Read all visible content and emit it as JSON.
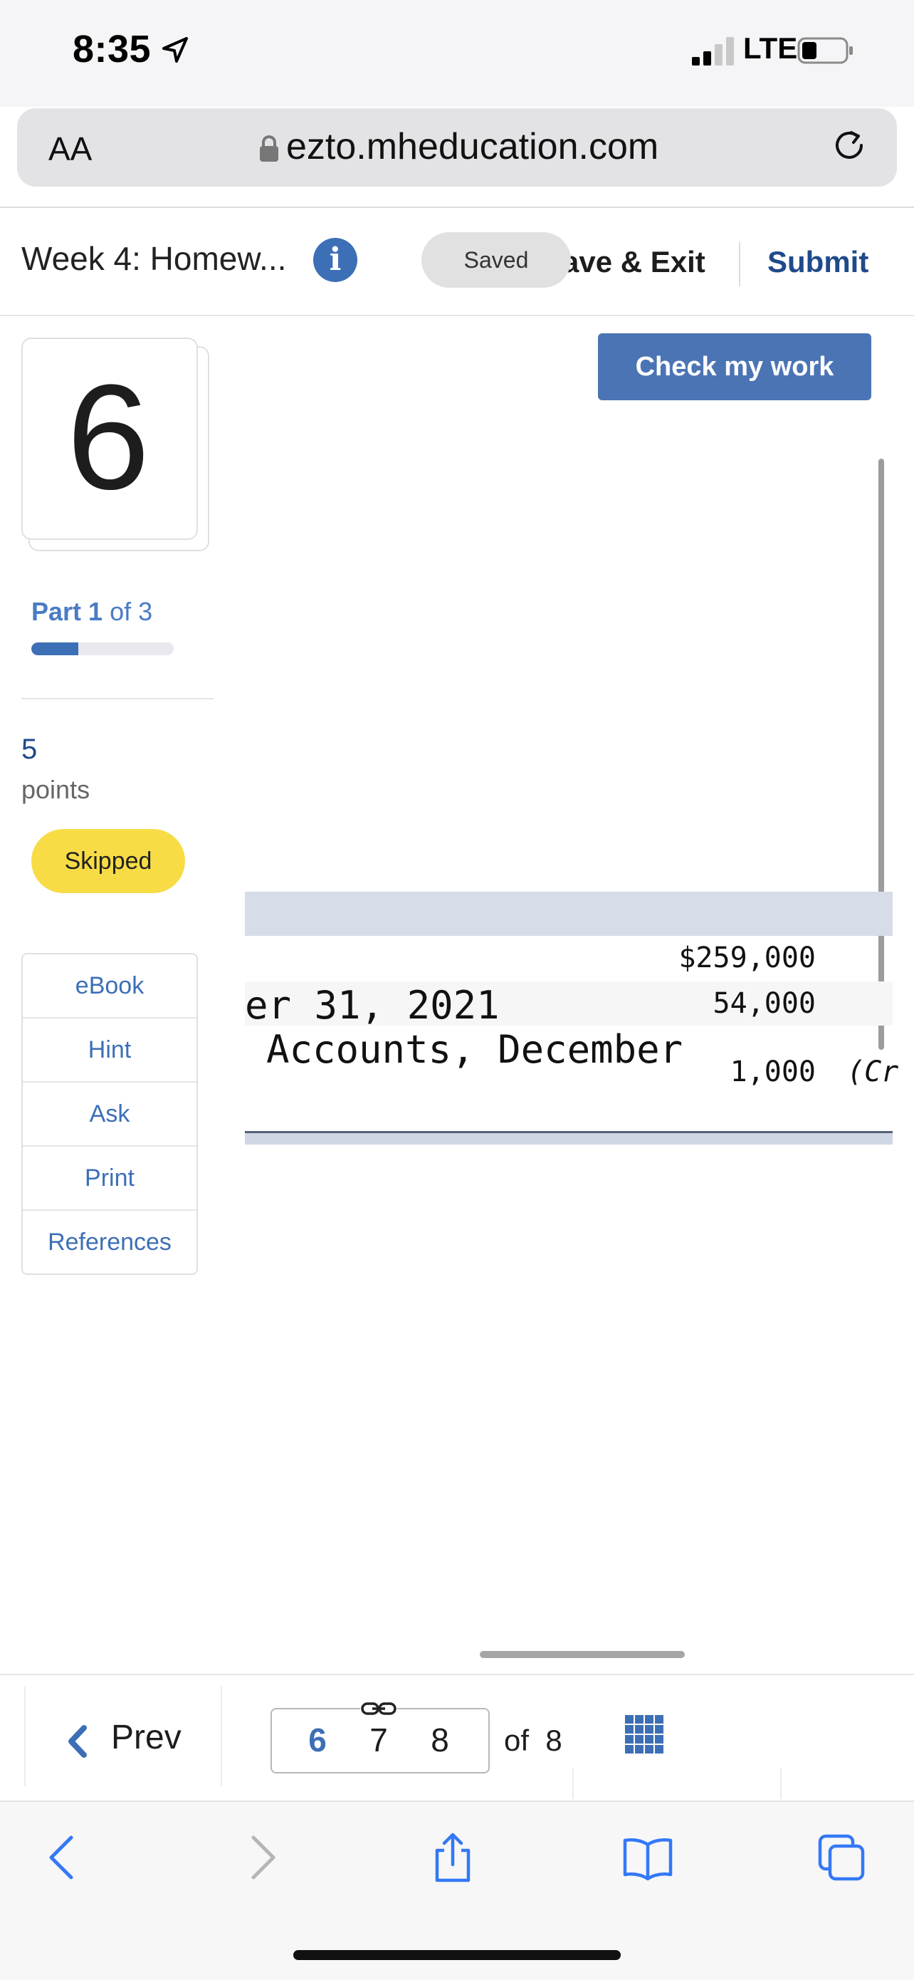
{
  "status_bar": {
    "time": "8:35",
    "network": "LTE"
  },
  "browser": {
    "text_size_label": "AA",
    "url": "ezto.mheducation.com"
  },
  "assignment": {
    "title": "Week 4: Homew...",
    "saved_label": "Saved",
    "save_exit_label": "ave & Exit",
    "submit_label": "Submit"
  },
  "question": {
    "number": "6",
    "part_word": "Part",
    "part_number": "1",
    "part_of": "of 3",
    "part_progress": 0.33,
    "points_value": "5",
    "points_label": "points",
    "status": "Skipped",
    "tools": [
      "eBook",
      "Hint",
      "Ask",
      "Print",
      "References"
    ],
    "check_button": "Check my work"
  },
  "table": {
    "rows": [
      {
        "text": "",
        "amount": "$259,000",
        "note": ""
      },
      {
        "text": "er 31, 2021",
        "amount": "54,000",
        "note": ""
      },
      {
        "text": "Accounts, December",
        "amount": "1,000",
        "note": "(Cr"
      }
    ]
  },
  "question_nav": {
    "prev_label": "Prev",
    "pages": [
      "6",
      "7",
      "8"
    ],
    "current": "6",
    "of_label": "of",
    "total": "8"
  },
  "colors": {
    "accent": "#3d6fb6",
    "submit": "#1f4a8a",
    "skipped": "#f7dc46",
    "check_button": "#4b74b5"
  },
  "icons": [
    "location-arrow-icon",
    "signal-icon",
    "battery-icon",
    "lock-icon",
    "reload-icon",
    "info-icon",
    "link-icon",
    "grid-icon",
    "back-icon",
    "forward-icon",
    "share-icon",
    "bookmarks-icon",
    "tabs-icon"
  ]
}
